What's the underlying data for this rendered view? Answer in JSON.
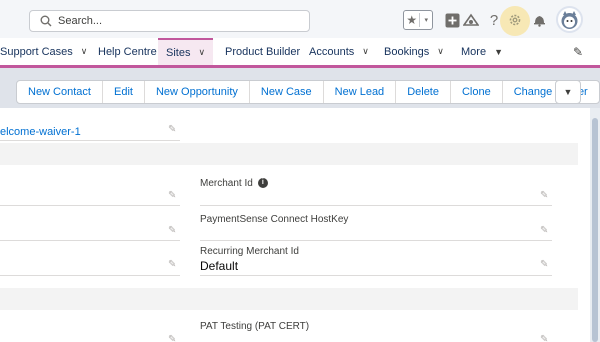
{
  "header": {
    "search_placeholder": "Search..."
  },
  "nav": {
    "items": [
      {
        "label": "Support Cases",
        "chevron": "∨"
      },
      {
        "label": "Help Centre"
      },
      {
        "label": "Sites",
        "chevron": "∨",
        "active": true
      },
      {
        "label": "Product Builder"
      },
      {
        "label": "Accounts",
        "chevron": "∨"
      },
      {
        "label": "Bookings",
        "chevron": "∨"
      },
      {
        "label": "More",
        "chevron": "▼"
      }
    ]
  },
  "actions": {
    "buttons": [
      "New Contact",
      "Edit",
      "New Opportunity",
      "New Case",
      "New Lead",
      "Delete",
      "Clone",
      "Change Owner"
    ]
  },
  "record": {
    "name": "elcome-waiver-1"
  },
  "fields": {
    "merchant_id": {
      "label": "Merchant Id",
      "value": ""
    },
    "paymentsense_connect_hostkey": {
      "label": "PaymentSense Connect HostKey",
      "value": ""
    },
    "recurring_merchant_id": {
      "label": "Recurring Merchant Id",
      "value": "Default"
    },
    "pat_testing": {
      "label": "PAT Testing (PAT CERT)",
      "value": ""
    }
  },
  "colors": {
    "link": "#0070d2",
    "nav_accent": "#c1579c",
    "gear_highlight": "#f7e8b5"
  },
  "icons": [
    "search-icon",
    "favorites-star-icon",
    "add-icon",
    "trailhead-icon",
    "help-icon",
    "setup-gear-icon",
    "notifications-bell-icon",
    "edit-pencil-icon",
    "info-icon"
  ]
}
